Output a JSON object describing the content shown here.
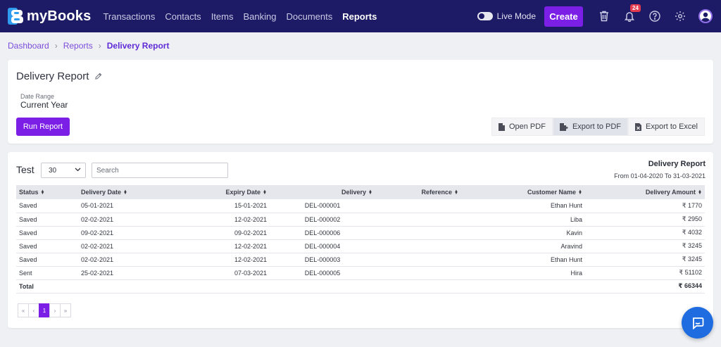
{
  "app": {
    "name": "mmyBooks",
    "brand": "myBooks"
  },
  "nav": {
    "links": [
      "Transactions",
      "Contacts",
      "Items",
      "Banking",
      "Documents",
      "Reports"
    ],
    "live_mode_label": "Live Mode",
    "create_label": "Create",
    "notification_count": "24"
  },
  "breadcrumb": {
    "items": [
      "Dashboard",
      "Reports"
    ],
    "current": "Delivery Report"
  },
  "report": {
    "title": "Delivery Report",
    "date_range_label": "Date Range",
    "date_range_value": "Current Year",
    "run_label": "Run Report",
    "open_pdf_label": "Open PDF",
    "export_pdf_label": "Export to PDF",
    "export_excel_label": "Export to Excel"
  },
  "table_section": {
    "test_label": "Test",
    "page_size": "30",
    "search_placeholder": "Search",
    "heading": "Delivery Report",
    "range": "From 01-04-2020 To 31-03-2021"
  },
  "table": {
    "columns": [
      "Status",
      "Delivery Date",
      "Expiry Date",
      "Delivery",
      "Reference",
      "Customer Name",
      "Delivery Amount"
    ],
    "rows": [
      [
        "Saved",
        "05-01-2021",
        "15-01-2021",
        "DEL-000001",
        "",
        "Ethan Hunt",
        "₹ 1770"
      ],
      [
        "Saved",
        "02-02-2021",
        "12-02-2021",
        "DEL-000002",
        "",
        "Liba",
        "₹ 2950"
      ],
      [
        "Saved",
        "09-02-2021",
        "09-02-2021",
        "DEL-000006",
        "",
        "Kavin",
        "₹ 4032"
      ],
      [
        "Saved",
        "02-02-2021",
        "12-02-2021",
        "DEL-000004",
        "",
        "Aravind",
        "₹ 3245"
      ],
      [
        "Saved",
        "02-02-2021",
        "12-02-2021",
        "DEL-000003",
        "",
        "Ethan Hunt",
        "₹ 3245"
      ],
      [
        "Sent",
        "25-02-2021",
        "07-03-2021",
        "DEL-000005",
        "",
        "Hira",
        "₹ 51102"
      ]
    ],
    "total_label": "Total",
    "total_amount": "₹ 66344"
  },
  "pager": {
    "first": "«",
    "prev": "‹",
    "current": "1",
    "next": "›",
    "last": "»"
  },
  "colors": {
    "nav_bg": "#1d1b66",
    "accent": "#7c1fe6",
    "chat": "#1e6ce0"
  }
}
